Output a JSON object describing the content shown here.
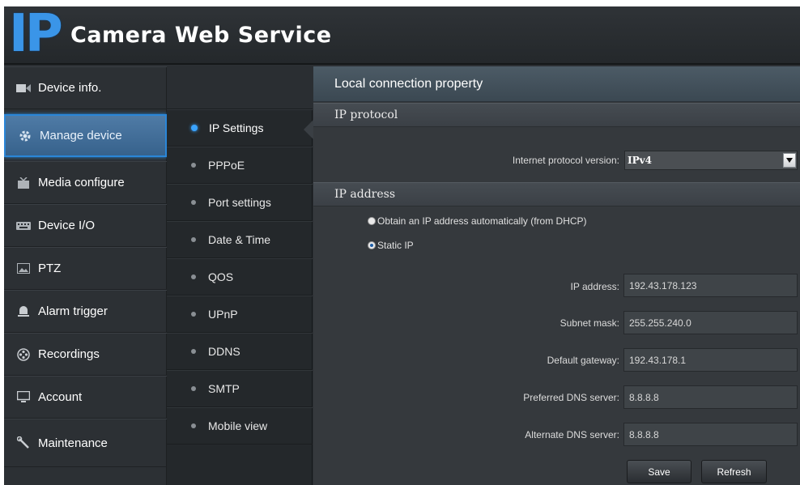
{
  "header": {
    "logo_text": "IP",
    "title": "Camera Web Service"
  },
  "nav": {
    "items": [
      {
        "label": "Device info.",
        "icon": "video-camera-icon"
      },
      {
        "label": "Manage device",
        "icon": "gear-icon",
        "active": true
      },
      {
        "label": "Media configure",
        "icon": "media-icon"
      },
      {
        "label": "Device I/O",
        "icon": "keyboard-icon"
      },
      {
        "label": "PTZ",
        "icon": "image-icon"
      },
      {
        "label": "Alarm trigger",
        "icon": "bell-icon"
      },
      {
        "label": "Recordings",
        "icon": "film-reel-icon"
      },
      {
        "label": "Account",
        "icon": "monitor-icon"
      },
      {
        "label": "Maintenance",
        "icon": "wrench-icon"
      }
    ]
  },
  "subnav": {
    "items": [
      {
        "label": "IP Settings",
        "active": true
      },
      {
        "label": "PPPoE"
      },
      {
        "label": "Port settings"
      },
      {
        "label": "Date & Time"
      },
      {
        "label": "QOS"
      },
      {
        "label": "UPnP"
      },
      {
        "label": "DDNS"
      },
      {
        "label": "SMTP"
      },
      {
        "label": "Mobile view"
      }
    ]
  },
  "main": {
    "title": "Local connection property",
    "ip_protocol": {
      "heading": "IP protocol",
      "version_label": "Internet protocol version:",
      "version_value": "IPv4"
    },
    "ip_address": {
      "heading": "IP address",
      "radio_dhcp": "Obtain an IP address automatically (from DHCP)",
      "radio_static": "Static IP",
      "selected": "static",
      "fields": {
        "ip_address": {
          "label": "IP address:",
          "value": "192.43.178.123"
        },
        "subnet_mask": {
          "label": "Subnet mask:",
          "value": "255.255.240.0"
        },
        "default_gateway": {
          "label": "Default gateway:",
          "value": "192.43.178.1"
        },
        "preferred_dns": {
          "label": "Preferred DNS server:",
          "value": "8.8.8.8"
        },
        "alternate_dns": {
          "label": "Alternate DNS server:",
          "value": "8.8.8.8"
        }
      }
    },
    "buttons": {
      "save": "Save",
      "refresh": "Refresh"
    }
  },
  "colors": {
    "accent": "#3a95e8",
    "active_nav": "#4a76a2",
    "panel": "#35393d",
    "nav_bg": "#2c3034"
  }
}
